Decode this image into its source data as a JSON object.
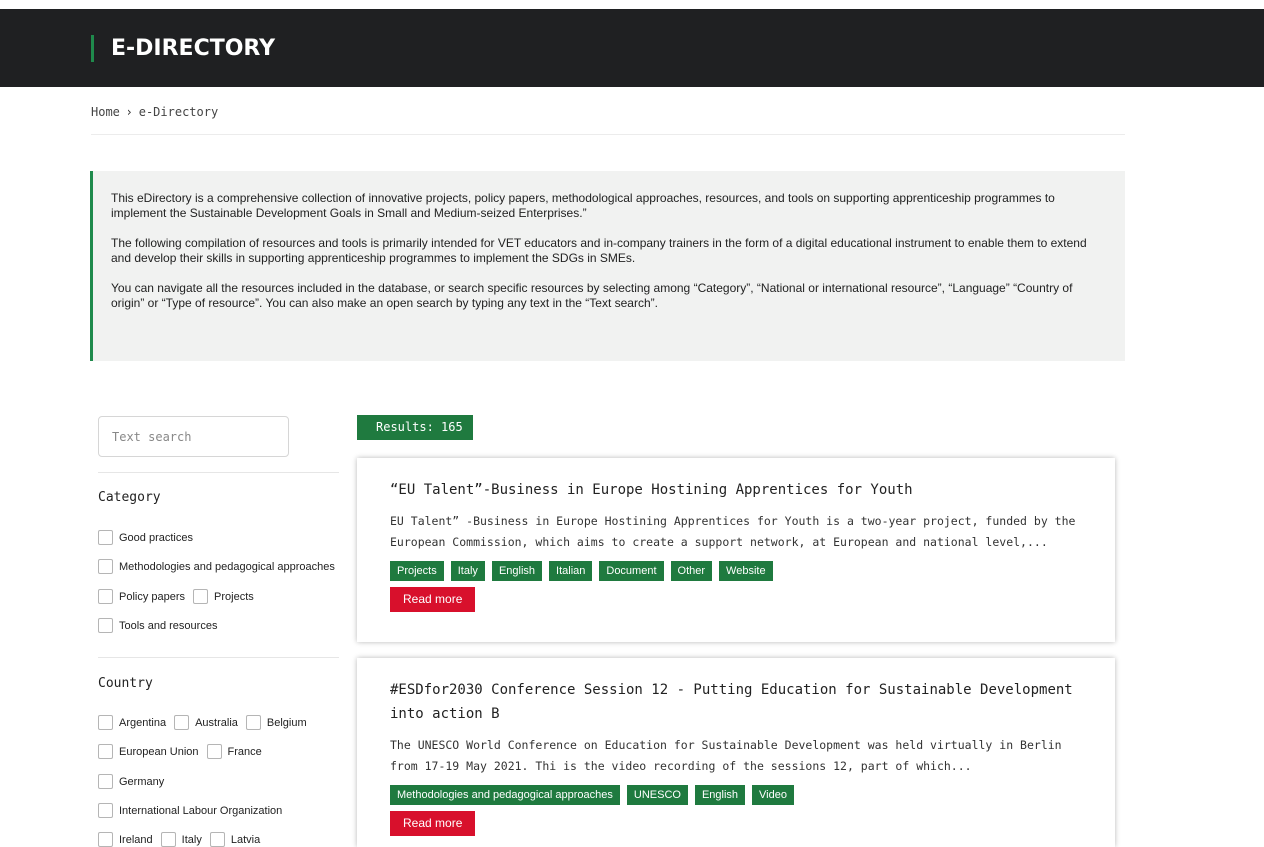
{
  "header": {
    "title": "E-DIRECTORY"
  },
  "breadcrumb": {
    "home": "Home",
    "separator": "›",
    "current": "e-Directory"
  },
  "intro": {
    "p1": "This eDirectory is a comprehensive collection of innovative projects, policy papers, methodological approaches, resources, and tools on supporting apprenticeship programmes to implement the Sustainable Development Goals in Small and Medium-seized Enterprises.”",
    "p2": "The following compilation of resources and tools is primarily intended for VET educators and in-company trainers in the form of a digital educational instrument to enable them to extend and develop their skills in supporting apprenticeship programmes to implement the SDGs in SMEs.",
    "p3": "You can navigate all the resources included in the database, or search specific resources by selecting among “Category”, “National or international resource”, “Language” “Country of origin” or “Type of resource”. You can also make an open search by typing any text in the “Text search”."
  },
  "filters": {
    "search_placeholder": "Text search",
    "category": {
      "title": "Category",
      "options": [
        "Good practices",
        "Methodologies and pedagogical approaches",
        "Policy papers",
        "Projects",
        "Tools and resources"
      ]
    },
    "country": {
      "title": "Country",
      "options": [
        "Argentina",
        "Australia",
        "Belgium",
        "European Union",
        "France",
        "Germany",
        "International Labour Organization",
        "Ireland",
        "Italy",
        "Latvia"
      ]
    }
  },
  "results": {
    "label": "Results: 165",
    "read_more": "Read more",
    "items": [
      {
        "title": "“EU Talent”-Business in Europe Hostining Apprentices for Youth",
        "description": "EU Talent” -Business in Europe Hostining Apprentices for Youth is a two-year project, funded by the European Commission, which aims to create a support network, at European and national level,...",
        "tags": [
          "Projects",
          "Italy",
          "English",
          "Italian",
          "Document",
          "Other",
          "Website"
        ]
      },
      {
        "title": "#ESDfor2030 Conference Session 12 - Putting Education for Sustainable Development into action B",
        "description": "The UNESCO World Conference on Education for Sustainable Development was held virtually in Berlin from 17-19 May 2021. Thi is the video recording of the sessions 12, part of which...",
        "tags": [
          "Methodologies and pedagogical approaches",
          "UNESCO",
          "English",
          "Video"
        ]
      }
    ]
  },
  "colors": {
    "header_bg": "#1f2022",
    "accent_green": "#1f7a3f",
    "read_more_red": "#d8102c",
    "intro_bg": "#f1f2f1"
  }
}
